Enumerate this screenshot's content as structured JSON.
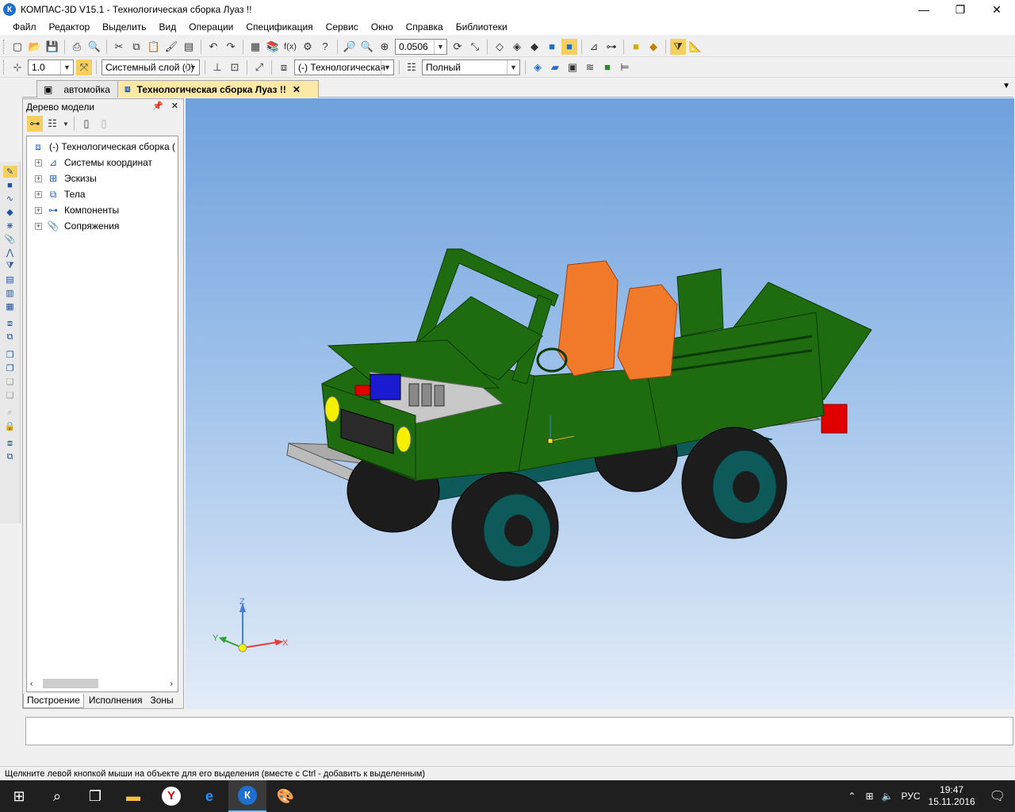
{
  "window": {
    "title": "КОМПАС-3D V15.1 - Технологическая сборка Луаз !!",
    "app_icon_letter": "К"
  },
  "menu": [
    "Файл",
    "Редактор",
    "Выделить",
    "Вид",
    "Операции",
    "Спецификация",
    "Сервис",
    "Окно",
    "Справка",
    "Библиотеки"
  ],
  "toolbar1": {
    "zoom_value": "0.0506"
  },
  "toolbar2": {
    "scale_value": "1.0",
    "layer_value": "Системный слой (0)",
    "object_value": "(-) Технологическая",
    "mode_value": "Полный"
  },
  "tabs": [
    {
      "label": "автомойка"
    },
    {
      "label": "Технологическая сборка Луаз !!"
    }
  ],
  "tree": {
    "header": "Дерево модели",
    "root": "(-) Технологическая сборка (",
    "items": [
      {
        "label": "Системы координат",
        "icon": "coordinate-systems-icon"
      },
      {
        "label": "Эскизы",
        "icon": "sketches-icon"
      },
      {
        "label": "Тела",
        "icon": "bodies-icon"
      },
      {
        "label": "Компоненты",
        "icon": "components-icon"
      },
      {
        "label": "Сопряжения",
        "icon": "mates-icon"
      }
    ],
    "bottom_tabs": [
      "Построение",
      "Исполнения",
      "Зоны"
    ]
  },
  "viewport": {
    "axis_x": "X",
    "axis_y": "Y",
    "axis_z": "Z",
    "colors": {
      "body": "#1f6b10",
      "seat": "#f07a2a",
      "wheel": "#1c1c1c",
      "rim": "#0e5a5a",
      "headlight": "#f5f000"
    }
  },
  "status": "Щелкните левой кнопкой мыши на объекте для его выделения (вместе с Ctrl - добавить к выделенным)",
  "taskbar": {
    "language": "РУС",
    "time": "19:47",
    "date": "15.11.2016"
  }
}
